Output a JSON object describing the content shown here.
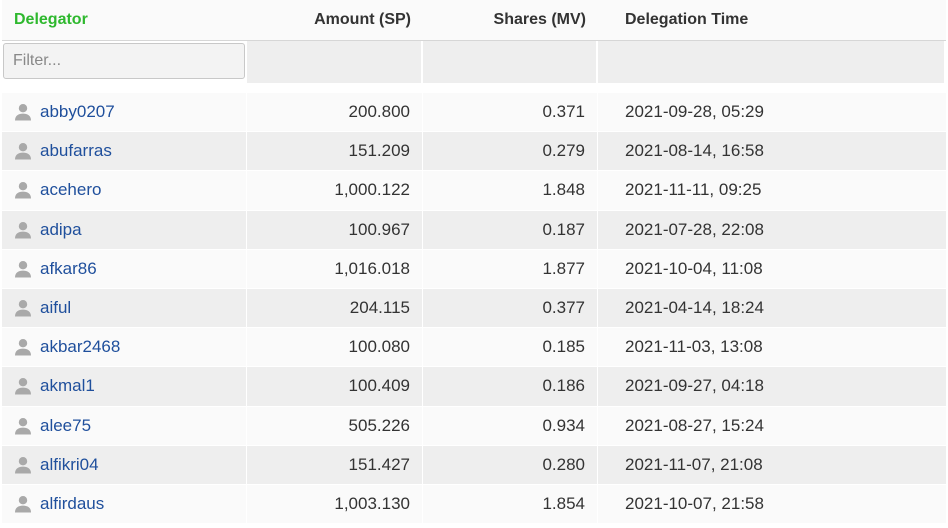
{
  "colors": {
    "delegator_header": "#2eb82e",
    "link": "#1f4f9c",
    "row_alt": "#eeeeee",
    "row": "#fafafa",
    "user_icon": "#a9a9a9"
  },
  "table": {
    "headers": {
      "delegator": "Delegator",
      "amount": "Amount (SP)",
      "shares": "Shares (MV)",
      "time": "Delegation Time"
    },
    "filter_placeholder": "Filter...",
    "rows": [
      {
        "delegator": "abby0207",
        "amount": "200.800",
        "shares": "0.371",
        "time": "2021-09-28, 05:29"
      },
      {
        "delegator": "abufarras",
        "amount": "151.209",
        "shares": "0.279",
        "time": "2021-08-14, 16:58"
      },
      {
        "delegator": "acehero",
        "amount": "1,000.122",
        "shares": "1.848",
        "time": "2021-11-11, 09:25"
      },
      {
        "delegator": "adipa",
        "amount": "100.967",
        "shares": "0.187",
        "time": "2021-07-28, 22:08"
      },
      {
        "delegator": "afkar86",
        "amount": "1,016.018",
        "shares": "1.877",
        "time": "2021-10-04, 11:08"
      },
      {
        "delegator": "aiful",
        "amount": "204.115",
        "shares": "0.377",
        "time": "2021-04-14, 18:24"
      },
      {
        "delegator": "akbar2468",
        "amount": "100.080",
        "shares": "0.185",
        "time": "2021-11-03, 13:08"
      },
      {
        "delegator": "akmal1",
        "amount": "100.409",
        "shares": "0.186",
        "time": "2021-09-27, 04:18"
      },
      {
        "delegator": "alee75",
        "amount": "505.226",
        "shares": "0.934",
        "time": "2021-08-27, 15:24"
      },
      {
        "delegator": "alfikri04",
        "amount": "151.427",
        "shares": "0.280",
        "time": "2021-11-07, 21:08"
      },
      {
        "delegator": "alfirdaus",
        "amount": "1,003.130",
        "shares": "1.854",
        "time": "2021-10-07, 21:58"
      }
    ]
  }
}
